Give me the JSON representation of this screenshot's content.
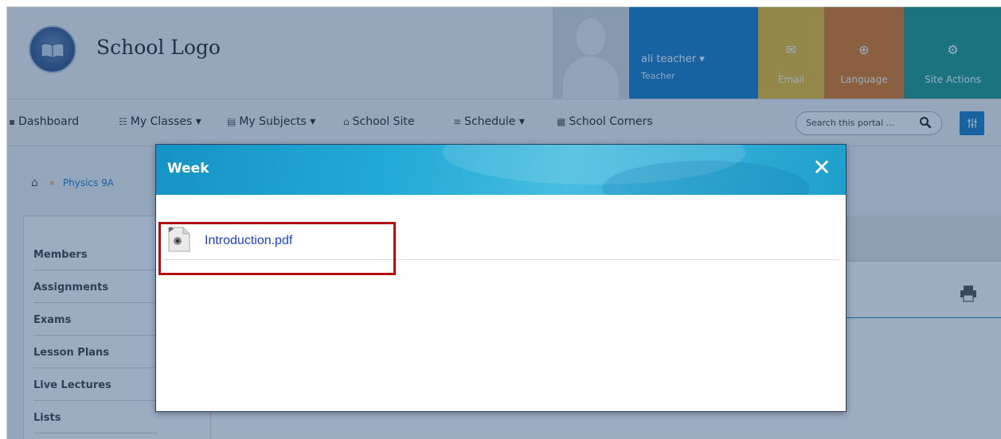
{
  "header": {
    "school_logo": "School Logo",
    "user_name": "ali teacher",
    "user_caret": "▾",
    "user_role": "Teacher",
    "tiles": {
      "email": "Email",
      "language": "Language",
      "site_actions": "Site Actions"
    }
  },
  "nav": {
    "items": [
      {
        "label": "Dashboard",
        "icon": "▪"
      },
      {
        "label": "My Classes",
        "icon": "☷",
        "caret": "▾"
      },
      {
        "label": "My Subjects",
        "icon": "▤",
        "caret": "▾"
      },
      {
        "label": "School Site",
        "icon": "⌂"
      },
      {
        "label": "Schedule",
        "icon": "≡",
        "caret": "▾"
      },
      {
        "label": "School Corners",
        "icon": "▦"
      }
    ],
    "search_placeholder": "Search this portal ...",
    "search_icon": "search-icon",
    "filter_icon": "sliders-icon"
  },
  "breadcrumb": {
    "home_icon": "home-icon",
    "separator": "»",
    "item": "Physics 9A"
  },
  "sidebar": {
    "items": [
      "Members",
      "Assignments",
      "Exams",
      "Lesson Plans",
      "Live Lectures",
      "Lists"
    ]
  },
  "modal": {
    "title": "Week",
    "close_symbol": "✕",
    "files": [
      {
        "name": "Introduction.pdf",
        "icon": "pdf-file-icon"
      }
    ]
  },
  "colors": {
    "brand_blue": "#1a7fc6",
    "email_tile": "#f0c02f",
    "language_tile": "#e07a22",
    "site_actions_tile": "#1f9c8b",
    "highlight_box": "#b01010",
    "link": "#1f3fd1"
  }
}
